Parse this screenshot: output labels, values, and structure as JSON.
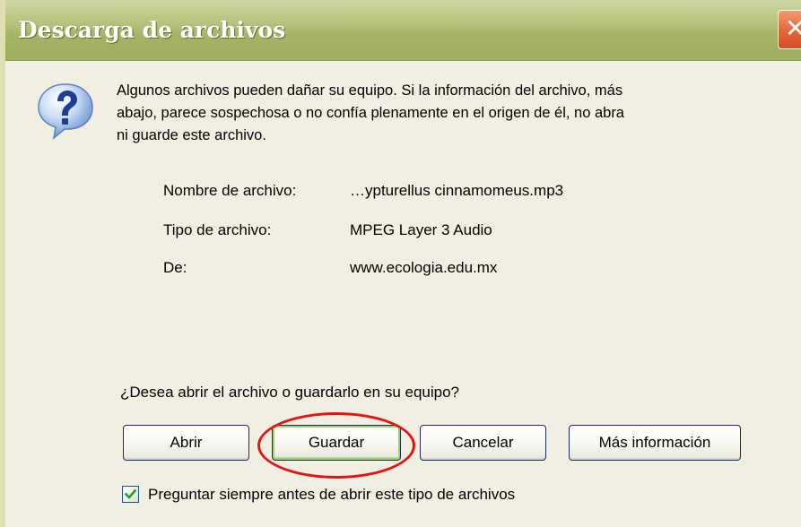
{
  "window": {
    "title": "Descarga de archivos",
    "close_glyph": "✕",
    "colors": {
      "titlebar": "#a5b366",
      "body": "#f1efe2",
      "button_border": "#1f2b6b",
      "highlight": "#e41414",
      "default_button_glow": "#9fd16b"
    }
  },
  "dialog": {
    "icon": "question-icon",
    "warning": "Algunos archivos pueden dañar su equipo. Si la información del archivo, más\nabajo, parece sospechosa o no confía plenamente en el origen de él, no abra\nni guarde este archivo.",
    "file_info": [
      {
        "label": "Nombre de archivo:",
        "value": "…ypturellus cinnamomeus.mp3"
      },
      {
        "label": "Tipo de archivo:",
        "value": "MPEG Layer 3 Audio"
      },
      {
        "label": "De:",
        "value": "www.ecologia.edu.mx"
      }
    ],
    "question": "¿Desea abrir el archivo o guardarlo en su equipo?",
    "buttons": {
      "open": "Abrir",
      "save": "Guardar",
      "cancel": "Cancelar",
      "more_info": "Más información"
    },
    "highlighted_button": "save",
    "checkbox": {
      "checked": true,
      "label": "Preguntar siempre antes de abrir este tipo de archivos"
    }
  }
}
